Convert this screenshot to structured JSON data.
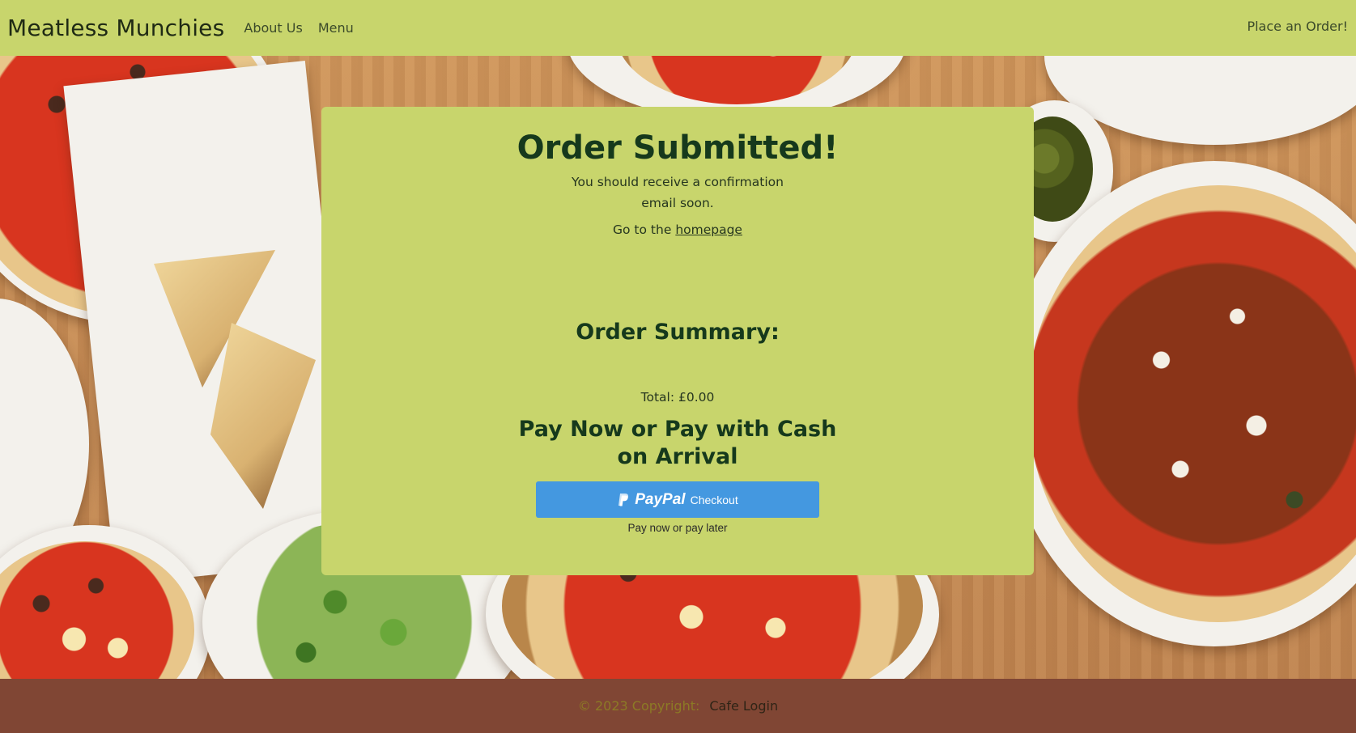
{
  "nav": {
    "brand": "Meatless Munchies",
    "links": [
      "About Us",
      "Menu"
    ],
    "order": "Place an Order!"
  },
  "card": {
    "title": "Order Submitted!",
    "message": "You should receive a confirmation email soon.",
    "home_prefix": "Go to the",
    "home_link": "homepage",
    "summary_title": "Order Summary:",
    "total_text": "Total: £0.00",
    "pay_title": "Pay Now or Pay with Cash on Arrival",
    "paypal": {
      "brand": "PayPal",
      "label": "Checkout",
      "subtext": "Pay now or pay later"
    }
  },
  "footer": {
    "copyright": "© 2023 Copyright:",
    "login": "Cafe Login"
  },
  "colors": {
    "navbar": "#c8d56c",
    "card": "#c8d56c",
    "footer": "#804634",
    "paypal_button": "#4498e0",
    "heading": "#16391c"
  },
  "icons": [
    "paypal-logo-icon"
  ]
}
